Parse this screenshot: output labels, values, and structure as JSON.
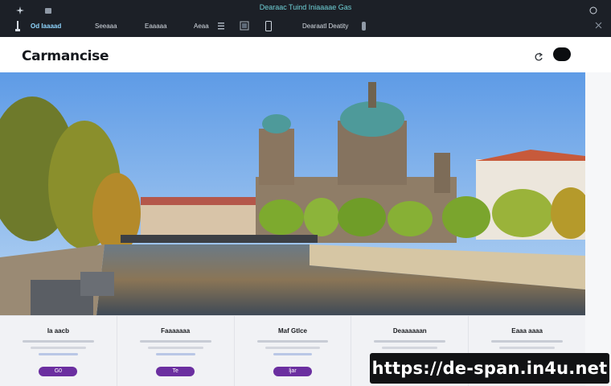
{
  "topbar": {
    "window_title": "Dearaac Tuind Iniaaaae Gas",
    "nav": {
      "brand": "Od Iaaaad",
      "item2": "Seeaaa",
      "item3": "Eaaaaa",
      "item4": "Aeaa",
      "item5": "Dearaatl Deatity"
    },
    "icons": [
      "sparkle-icon",
      "folder-icon",
      "lamp-icon",
      "settings-icon",
      "globe-icon"
    ]
  },
  "page": {
    "title": "Carmancise"
  },
  "hero": {
    "scene": "berlin-cathedral-river"
  },
  "cards": [
    {
      "title": "Ia aacb",
      "button": "G0"
    },
    {
      "title": "Faaaaaaa",
      "button": "Te"
    },
    {
      "title": "Maf Gtlce",
      "button": "ljar"
    },
    {
      "title": "Deaaaaaan",
      "button": ""
    },
    {
      "title": "Eaaa aaaa",
      "button": ""
    }
  ],
  "watermark": {
    "text": "https://de-span.in4u.net"
  },
  "colors": {
    "topbar_bg": "#1c2027",
    "accent_purple": "#6b2fa0",
    "sky": "#7fb7f0"
  }
}
